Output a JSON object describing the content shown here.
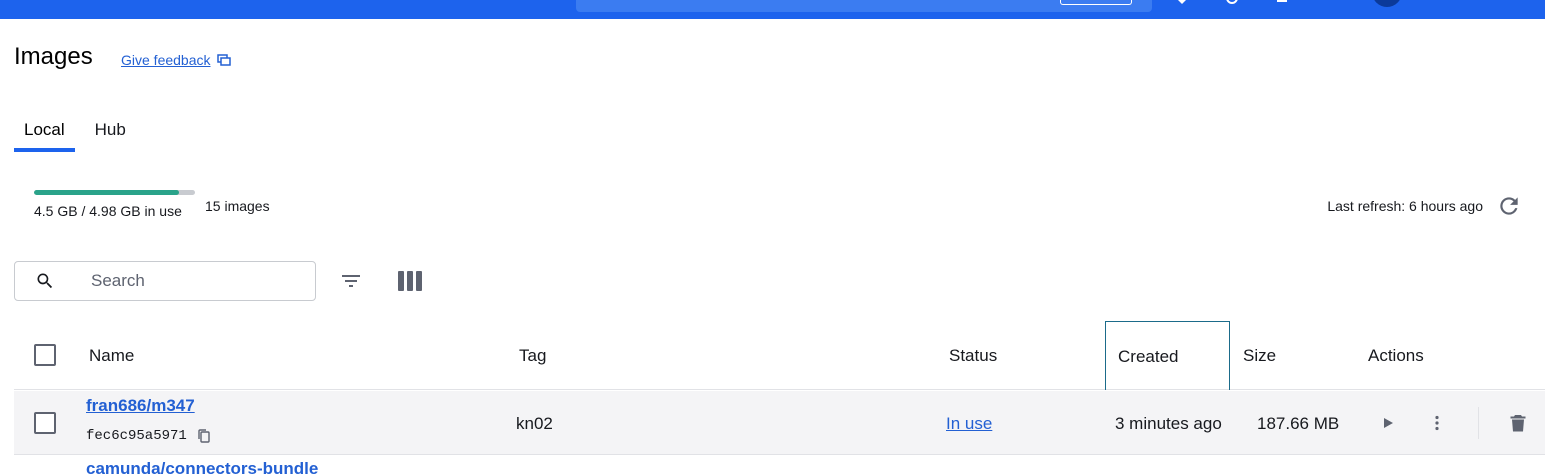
{
  "header": {
    "page_title": "Images",
    "feedback_label": "Give feedback"
  },
  "tabs": [
    {
      "label": "Local",
      "active": true
    },
    {
      "label": "Hub",
      "active": false
    }
  ],
  "usage": {
    "text": "4.5 GB / 4.98 GB in use",
    "fraction_used": 0.9036,
    "image_count": "15 images",
    "last_refresh": "Last refresh: 6 hours ago"
  },
  "search": {
    "placeholder": "Search"
  },
  "table": {
    "columns": [
      "Name",
      "Tag",
      "Status",
      "Created",
      "Size",
      "Actions"
    ],
    "rows": [
      {
        "name": "fran686/m347",
        "id": "fec6c95a5971",
        "tag": "kn02",
        "status": "In use",
        "created": "3 minutes ago",
        "size": "187.66 MB"
      },
      {
        "name": "camunda/connectors-bundle"
      }
    ]
  },
  "colors": {
    "accent": "#1d63ed",
    "link": "#2360d3",
    "usage_fill": "#2aa38a"
  }
}
